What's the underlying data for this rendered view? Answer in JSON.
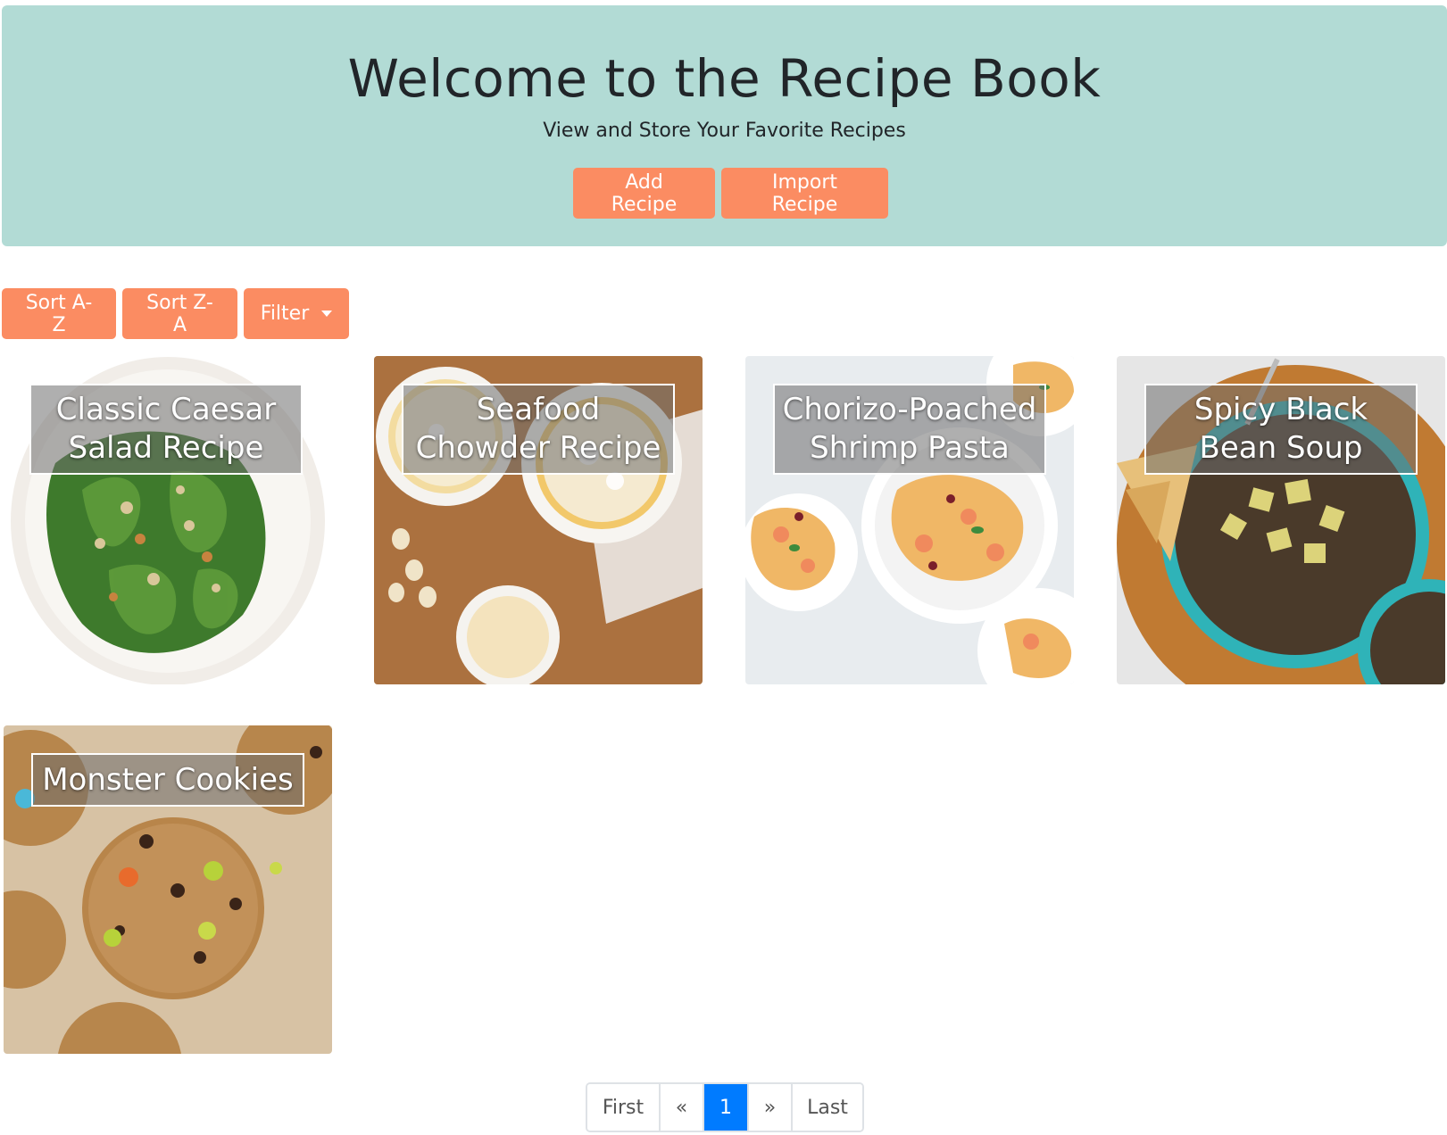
{
  "header": {
    "title": "Welcome to the Recipe Book",
    "subtitle": "View and Store Your Favorite Recipes",
    "add_label": "Add Recipe",
    "import_label": "Import Recipe"
  },
  "toolbar": {
    "sort_az_label": "Sort A-Z",
    "sort_za_label": "Sort Z-A",
    "filter_label": "Filter"
  },
  "recipes": [
    {
      "title": "Classic Caesar Salad Recipe"
    },
    {
      "title": "Seafood Chowder Recipe"
    },
    {
      "title": "Chorizo-Poached Shrimp Pasta"
    },
    {
      "title": "Spicy Black Bean Soup"
    },
    {
      "title": "Monster Cookies"
    }
  ],
  "pagination": {
    "first_label": "First",
    "prev_label": "«",
    "current_page": "1",
    "next_label": "»",
    "last_label": "Last"
  },
  "colors": {
    "hero_bg": "#b2dbd5",
    "button": "#fb8c62",
    "active_page": "#007bff"
  }
}
